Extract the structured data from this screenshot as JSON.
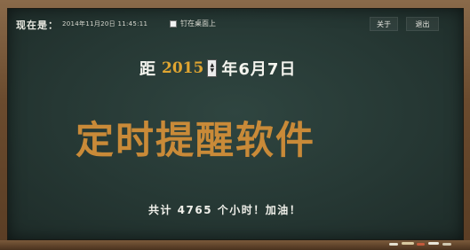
{
  "topbar": {
    "now_label": "现在是：",
    "clock": "2014年11月20日 11:45:11",
    "pin_label": "钉在桌面上",
    "about_label": "关于",
    "exit_label": "退出"
  },
  "deadline": {
    "prefix": "距",
    "year": "2015",
    "date": "年6月7日"
  },
  "app_title": "定时提醒软件",
  "total_text": "共计 4765 个小时！加油！",
  "colors": {
    "board": "#263834",
    "title": "#c98a38",
    "year": "#e0a531",
    "frame": "#6b4b2e"
  }
}
